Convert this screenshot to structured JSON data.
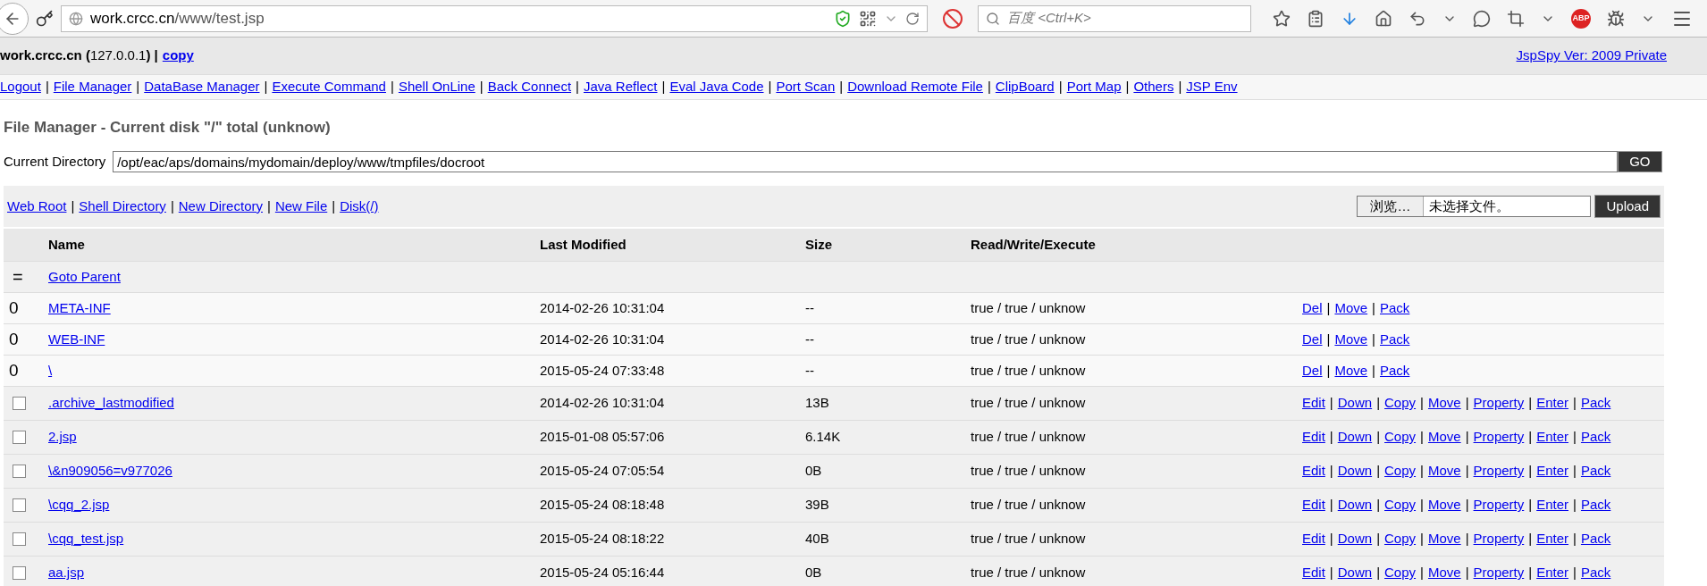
{
  "browser": {
    "url_host": "work.crcc.cn",
    "url_path": "/www/test.jsp",
    "search_placeholder": "百度 <Ctrl+K>",
    "adblock_label": "ABP"
  },
  "link_separator": "|",
  "host_bar": {
    "host_info": "**work.crcc.cn (**127.0.0.1**) |**",
    "copy_link": "copy",
    "version_link": "JspSpy Ver: 2009 Private"
  },
  "nav_links": [
    "Logout",
    "File Manager",
    "DataBase Manager",
    "Execute Command",
    "Shell OnLine",
    "Back Connect",
    "Java Reflect",
    "Eval Java Code",
    "Port Scan",
    "Download Remote File",
    "ClipBoard",
    "Port Map",
    "Others",
    "JSP Env"
  ],
  "page_title": "File Manager - Current disk \"/\" total (unknow)",
  "directory": {
    "label": "Current Directory",
    "value": "/opt/eac/aps/domains/mydomain/deploy/www/tmpfiles/docroot",
    "go_button": "GO"
  },
  "tool_links": [
    "Web Root",
    "Shell Directory",
    "New Directory",
    "New File",
    "Disk(/)"
  ],
  "upload": {
    "browse_button": "浏览…",
    "file_status": "未选择文件。",
    "upload_button": "Upload"
  },
  "table": {
    "columns": [
      "Name",
      "Last Modified",
      "Size",
      "Read/Write/Execute"
    ],
    "parent_row": {
      "marker": "=",
      "link": "Goto Parent"
    },
    "rows": [
      {
        "kind": "dir",
        "marker": "0",
        "name": "META-INF",
        "modified": "2014-02-26 10:31:04",
        "size": "--",
        "rwe": "true / true / unknow",
        "actions": [
          "Del",
          "Move",
          "Pack"
        ]
      },
      {
        "kind": "dir",
        "marker": "0",
        "name": "WEB-INF",
        "modified": "2014-02-26 10:31:04",
        "size": "--",
        "rwe": "true / true / unknow",
        "actions": [
          "Del",
          "Move",
          "Pack"
        ]
      },
      {
        "kind": "dir",
        "marker": "0",
        "name": "\\",
        "modified": "2015-05-24 07:33:48",
        "size": "--",
        "rwe": "true / true / unknow",
        "actions": [
          "Del",
          "Move",
          "Pack"
        ]
      },
      {
        "kind": "file",
        "checked": false,
        "name": ".archive_lastmodified",
        "modified": "2014-02-26 10:31:04",
        "size": "13B",
        "rwe": "true / true / unknow",
        "actions": [
          "Edit",
          "Down",
          "Copy",
          "Move",
          "Property",
          "Enter",
          "Pack"
        ]
      },
      {
        "kind": "file",
        "checked": false,
        "name": "2.jsp",
        "modified": "2015-01-08 05:57:06",
        "size": "6.14K",
        "rwe": "true / true / unknow",
        "actions": [
          "Edit",
          "Down",
          "Copy",
          "Move",
          "Property",
          "Enter",
          "Pack"
        ]
      },
      {
        "kind": "file",
        "checked": false,
        "name": "\\&n909056=v977026",
        "modified": "2015-05-24 07:05:54",
        "size": "0B",
        "rwe": "true / true / unknow",
        "actions": [
          "Edit",
          "Down",
          "Copy",
          "Move",
          "Property",
          "Enter",
          "Pack"
        ]
      },
      {
        "kind": "file",
        "checked": false,
        "name": "\\cqq_2.jsp",
        "modified": "2015-05-24 08:18:48",
        "size": "39B",
        "rwe": "true / true / unknow",
        "actions": [
          "Edit",
          "Down",
          "Copy",
          "Move",
          "Property",
          "Enter",
          "Pack"
        ]
      },
      {
        "kind": "file",
        "checked": false,
        "name": "\\cqq_test.jsp",
        "modified": "2015-05-24 08:18:22",
        "size": "40B",
        "rwe": "true / true / unknow",
        "actions": [
          "Edit",
          "Down",
          "Copy",
          "Move",
          "Property",
          "Enter",
          "Pack"
        ]
      },
      {
        "kind": "file",
        "checked": false,
        "name": "aa.jsp",
        "modified": "2015-05-24 05:16:44",
        "size": "0B",
        "rwe": "true / true / unknow",
        "actions": [
          "Edit",
          "Down",
          "Copy",
          "Move",
          "Property",
          "Enter",
          "Pack"
        ]
      }
    ]
  }
}
